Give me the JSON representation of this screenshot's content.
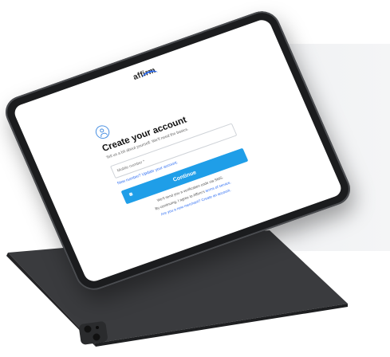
{
  "brand": {
    "logo_text": "affirm",
    "accent_color": "#1f9ee8",
    "link_color": "#2a6bf2"
  },
  "form": {
    "icon": "user-circle-icon",
    "title": "Create your account",
    "subtitle": "Tell us a bit about yourself. We'll need the basics.",
    "phone_placeholder": "Mobile number *",
    "update_prefix": "New number?",
    "update_link": "Update your account.",
    "continue_label": "Continue",
    "verification_note": "We'll send you a verification code via SMS.",
    "terms_prefix": "By continuing, I agree to Affirm's",
    "terms_link": "terms of service.",
    "merchant_prefix": "Are you a new merchant?",
    "merchant_link": "Create an account."
  },
  "devices": {
    "back_device_color": "#3b3c3f",
    "front_bezel_color": "#1b1c1e"
  }
}
